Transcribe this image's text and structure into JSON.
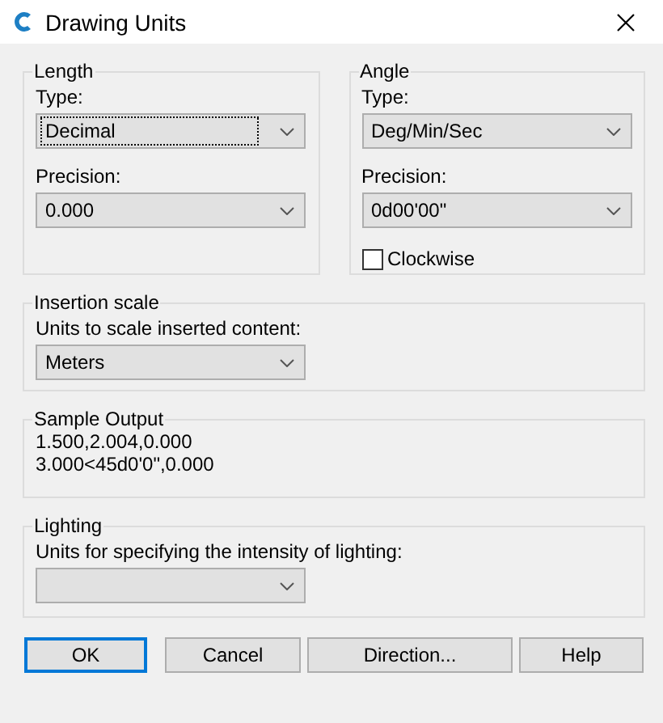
{
  "window": {
    "title": "Drawing Units"
  },
  "length": {
    "title": "Length",
    "type": {
      "label": "Type:",
      "value": "Decimal",
      "focused": true
    },
    "precision": {
      "label": "Precision:",
      "value": "0.000",
      "focused": false
    }
  },
  "angle": {
    "title": "Angle",
    "type": {
      "label": "Type:",
      "value": "Deg/Min/Sec",
      "focused": false
    },
    "precision": {
      "label": "Precision:",
      "value": "0d00'00\"",
      "focused": false
    },
    "clockwise": {
      "label": "Clockwise",
      "checked": false
    }
  },
  "insertion_scale": {
    "title": "Insertion scale",
    "label": "Units to scale inserted content:",
    "value": "Meters"
  },
  "sample_output": {
    "title": "Sample Output",
    "lines": [
      "1.500,2.004,0.000",
      "3.000<45d0'0\",0.000"
    ]
  },
  "lighting": {
    "title": "Lighting",
    "label": "Units for specifying the intensity of lighting:"
  },
  "buttons": [
    {
      "label": "OK",
      "default": true
    },
    {
      "label": "Cancel",
      "default": false
    },
    {
      "label": "Direction...",
      "default": false
    },
    {
      "label": "Help",
      "default": false
    }
  ]
}
